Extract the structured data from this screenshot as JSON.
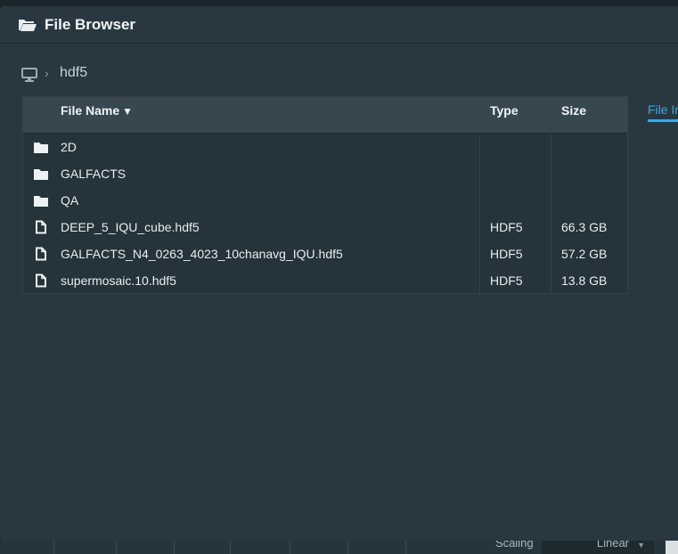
{
  "dialog": {
    "title": "File Browser",
    "title_icon": "folder-open-icon"
  },
  "breadcrumb": {
    "root_icon": "computer-icon",
    "separator": "›",
    "path": "hdf5"
  },
  "table": {
    "columns": {
      "name": "File Name",
      "type": "Type",
      "size": "Size"
    },
    "sort_indicator": "▼",
    "rows": [
      {
        "icon": "folder-icon",
        "name": "2D",
        "type": "",
        "size": ""
      },
      {
        "icon": "folder-icon",
        "name": "GALFACTS",
        "type": "",
        "size": ""
      },
      {
        "icon": "folder-icon",
        "name": "QA",
        "type": "",
        "size": ""
      },
      {
        "icon": "file-icon",
        "name": "DEEP_5_IQU_cube.hdf5",
        "type": "HDF5",
        "size": "66.3 GB"
      },
      {
        "icon": "file-icon",
        "name": "GALFACTS_N4_0263_4023_10chanavg_IQU.hdf5",
        "type": "HDF5",
        "size": "57.2 GB"
      },
      {
        "icon": "file-icon",
        "name": "supermosaic.10.hdf5",
        "type": "HDF5",
        "size": "13.8 GB"
      }
    ]
  },
  "side_tab": {
    "label": "File Information",
    "color": "#3fa9e0"
  },
  "background": {
    "label": "Scaling",
    "select_value": "Linear"
  }
}
